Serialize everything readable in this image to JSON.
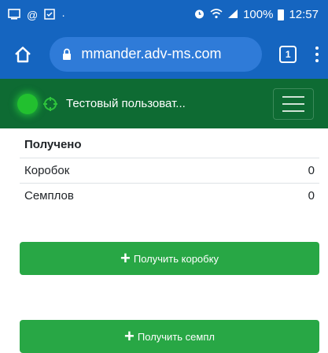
{
  "status_bar": {
    "left_icons": [
      "screen-icon",
      "at-icon",
      "checkbox-icon",
      "dot-icon"
    ],
    "battery_text": "100%",
    "time": "12:57"
  },
  "browser": {
    "url": "mmander.adv-ms.com",
    "tab_count": "1"
  },
  "navbar": {
    "user_name": "Тестовый пользоват...",
    "status_color": "#22c02f"
  },
  "received": {
    "title": "Получено",
    "rows": [
      {
        "label": "Коробок",
        "value": "0"
      },
      {
        "label": "Семплов",
        "value": "0"
      }
    ]
  },
  "buttons": {
    "get_box": "Получить коробку",
    "get_sample": "Получить семпл"
  },
  "colors": {
    "status_bar": "#1565c0",
    "navbar": "#0e6b33",
    "button": "#28a745"
  }
}
